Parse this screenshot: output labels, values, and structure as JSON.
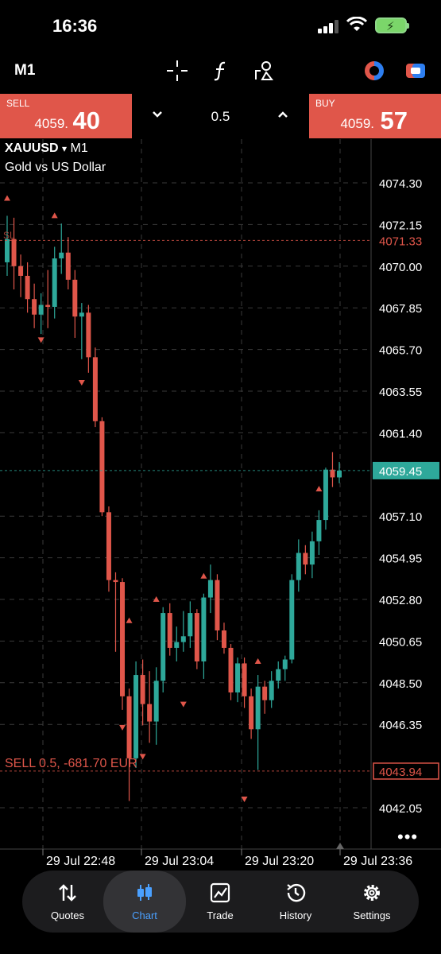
{
  "status_bar": {
    "time": "16:36"
  },
  "toolbar": {
    "timeframe": "M1",
    "icons": [
      "crosshair-icon",
      "indicators-icon",
      "objects-icon",
      "one-click-trading-icon",
      "toggle-icon"
    ]
  },
  "trade_panel": {
    "sell_label": "SELL",
    "sell_price_main": "4059.",
    "sell_price_big": "40",
    "buy_label": "BUY",
    "buy_price_main": "4059.",
    "buy_price_big": "57",
    "volume": "0.5"
  },
  "chart": {
    "symbol": "XAUUSD",
    "symbol_arrow": "▾",
    "timeframe": "M1",
    "description": "Gold vs US Dollar",
    "order_line_label": "SELL 0.5, -681.70 EUR",
    "current_price": "4059.45",
    "order_price": "4043.94",
    "sl_price": "4071.33",
    "sl_marker": "SL",
    "colors": {
      "up": "#2ea89a",
      "down": "#e0564a",
      "background": "#000000",
      "grid": "#3a3a3a"
    }
  },
  "chart_data": {
    "type": "candlestick",
    "y_ticks": [
      "4074.30",
      "4072.15",
      "4070.00",
      "4067.85",
      "4065.70",
      "4063.55",
      "4061.40",
      "4057.10",
      "4054.95",
      "4052.80",
      "4050.65",
      "4048.50",
      "4046.35",
      "4042.05"
    ],
    "y_tick_values": [
      4074.3,
      4072.15,
      4070.0,
      4067.85,
      4065.7,
      4063.55,
      4061.4,
      4057.1,
      4054.95,
      4052.8,
      4050.65,
      4048.5,
      4046.35,
      4042.05
    ],
    "x_ticks": [
      "29 Jul 22:48",
      "29 Jul 23:04",
      "29 Jul 23:20",
      "29 Jul 23:36"
    ],
    "horizontal_lines": [
      {
        "value": 4071.33,
        "label": "4071.33",
        "color": "#e0564a"
      },
      {
        "value": 4059.45,
        "label": "4059.45",
        "color": "#2ea89a"
      },
      {
        "value": 4043.94,
        "label": "4043.94",
        "color": "#e0564a"
      }
    ],
    "candles": [
      [
        4070.2,
        4072.6,
        4069.5,
        4071.4
      ],
      [
        4071.4,
        4072.5,
        4068.8,
        4070.0
      ],
      [
        4070.0,
        4070.6,
        4068.4,
        4069.5
      ],
      [
        4069.5,
        4070.2,
        4067.6,
        4068.3
      ],
      [
        4068.3,
        4069.1,
        4066.8,
        4067.5
      ],
      [
        4067.5,
        4068.6,
        4066.5,
        4068.0
      ],
      [
        4068.0,
        4069.8,
        4066.8,
        4067.9
      ],
      [
        4067.9,
        4071.0,
        4067.3,
        4070.4
      ],
      [
        4070.4,
        4072.2,
        4069.6,
        4070.7
      ],
      [
        4070.7,
        4071.5,
        4068.8,
        4069.3
      ],
      [
        4069.3,
        4069.8,
        4066.3,
        4067.4
      ],
      [
        4067.4,
        4068.1,
        4065.2,
        4067.6
      ],
      [
        4067.6,
        4068.0,
        4064.5,
        4065.3
      ],
      [
        4065.3,
        4065.8,
        4061.7,
        4062.0
      ],
      [
        4062.0,
        4062.2,
        4057.1,
        4057.3
      ],
      [
        4057.3,
        4057.6,
        4053.2,
        4053.8
      ],
      [
        4053.8,
        4054.2,
        4050.1,
        4053.7
      ],
      [
        4053.7,
        4053.9,
        4047.1,
        4047.8
      ],
      [
        4047.8,
        4048.2,
        4042.4,
        4044.6
      ],
      [
        4044.6,
        4049.6,
        4044.1,
        4048.9
      ],
      [
        4048.9,
        4049.7,
        4046.3,
        4047.4
      ],
      [
        4047.4,
        4049.1,
        4045.4,
        4046.5
      ],
      [
        4046.5,
        4049.3,
        4045.3,
        4048.6
      ],
      [
        4048.6,
        4052.4,
        4048.0,
        4052.1
      ],
      [
        4052.1,
        4052.6,
        4049.9,
        4050.3
      ],
      [
        4050.3,
        4051.4,
        4049.6,
        4050.6
      ],
      [
        4050.6,
        4052.2,
        4050.1,
        4050.9
      ],
      [
        4050.9,
        4052.7,
        4050.3,
        4052.1
      ],
      [
        4052.1,
        4052.3,
        4049.2,
        4049.6
      ],
      [
        4049.6,
        4053.1,
        4048.7,
        4052.9
      ],
      [
        4052.9,
        4054.6,
        4052.1,
        4053.8
      ],
      [
        4053.8,
        4054.1,
        4050.7,
        4051.2
      ],
      [
        4051.2,
        4051.6,
        4050.0,
        4050.3
      ],
      [
        4050.3,
        4050.5,
        4047.6,
        4048.0
      ],
      [
        4048.0,
        4049.8,
        4047.5,
        4049.5
      ],
      [
        4049.5,
        4049.8,
        4047.2,
        4047.8
      ],
      [
        4047.8,
        4048.2,
        4045.6,
        4046.1
      ],
      [
        4046.1,
        4048.9,
        4044.0,
        4048.3
      ],
      [
        4048.3,
        4048.6,
        4046.9,
        4047.6
      ],
      [
        4047.6,
        4049.1,
        4047.2,
        4048.6
      ],
      [
        4048.6,
        4049.6,
        4048.2,
        4049.2
      ],
      [
        4049.2,
        4049.9,
        4048.6,
        4049.7
      ],
      [
        4049.7,
        4054.1,
        4049.5,
        4053.8
      ],
      [
        4053.8,
        4055.9,
        4053.2,
        4055.2
      ],
      [
        4055.2,
        4055.6,
        4054.1,
        4054.6
      ],
      [
        4054.6,
        4056.3,
        4053.9,
        4055.8
      ],
      [
        4055.8,
        4057.4,
        4055.1,
        4056.9
      ],
      [
        4056.9,
        4059.6,
        4056.4,
        4059.5
      ],
      [
        4059.5,
        4060.4,
        4058.6,
        4059.1
      ],
      [
        4059.1,
        4059.9,
        4058.8,
        4059.45
      ]
    ],
    "fractals_up": [
      [
        0,
        4073.5
      ],
      [
        7,
        4072.6
      ],
      [
        22,
        4052.8
      ],
      [
        18,
        4051.7
      ],
      [
        29,
        4054.0
      ],
      [
        37,
        4049.6
      ],
      [
        46,
        4058.5
      ]
    ],
    "fractals_down": [
      [
        5,
        4066.2
      ],
      [
        11,
        4064.0
      ],
      [
        17,
        4046.2
      ],
      [
        20,
        4044.7
      ],
      [
        26,
        4047.4
      ],
      [
        35,
        4042.5
      ]
    ]
  },
  "nav": {
    "items": [
      {
        "label": "Quotes",
        "icon": "quotes-icon"
      },
      {
        "label": "Chart",
        "icon": "chart-icon"
      },
      {
        "label": "Trade",
        "icon": "trade-icon"
      },
      {
        "label": "History",
        "icon": "history-icon"
      },
      {
        "label": "Settings",
        "icon": "settings-icon"
      }
    ],
    "active": "Chart"
  }
}
